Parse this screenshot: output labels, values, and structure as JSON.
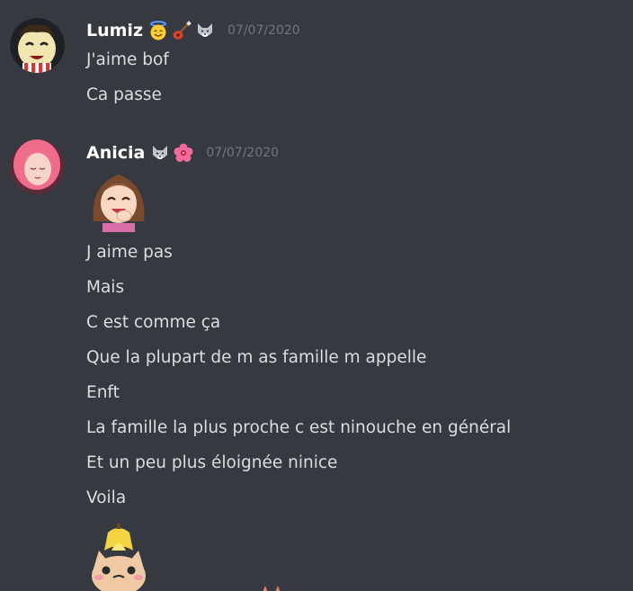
{
  "messages": [
    {
      "username": "Lumiz",
      "timestamp": "07/07/2020",
      "badges": [
        "smiling-face-with-halo-emoji",
        "guitar-emoji",
        "wolf-emoji"
      ],
      "lines": [
        "J'aime bof",
        "Ca passe"
      ]
    },
    {
      "username": "Anicia",
      "timestamp": "07/07/2020",
      "badges": [
        "wolf-emoji",
        "hibiscus-emoji"
      ],
      "lines": [
        "J aime pas",
        "Mais",
        "C est comme ça",
        "Que la plupart de m as famille m appelle",
        "Enft",
        "La famille la plus proche c est ninouche en général",
        "Et un peu plus éloignée ninice",
        "Voila"
      ]
    }
  ],
  "colors": {
    "background": "#36393f",
    "username": "#ffffff",
    "text": "#dcddde",
    "timestamp": "#72767d"
  }
}
